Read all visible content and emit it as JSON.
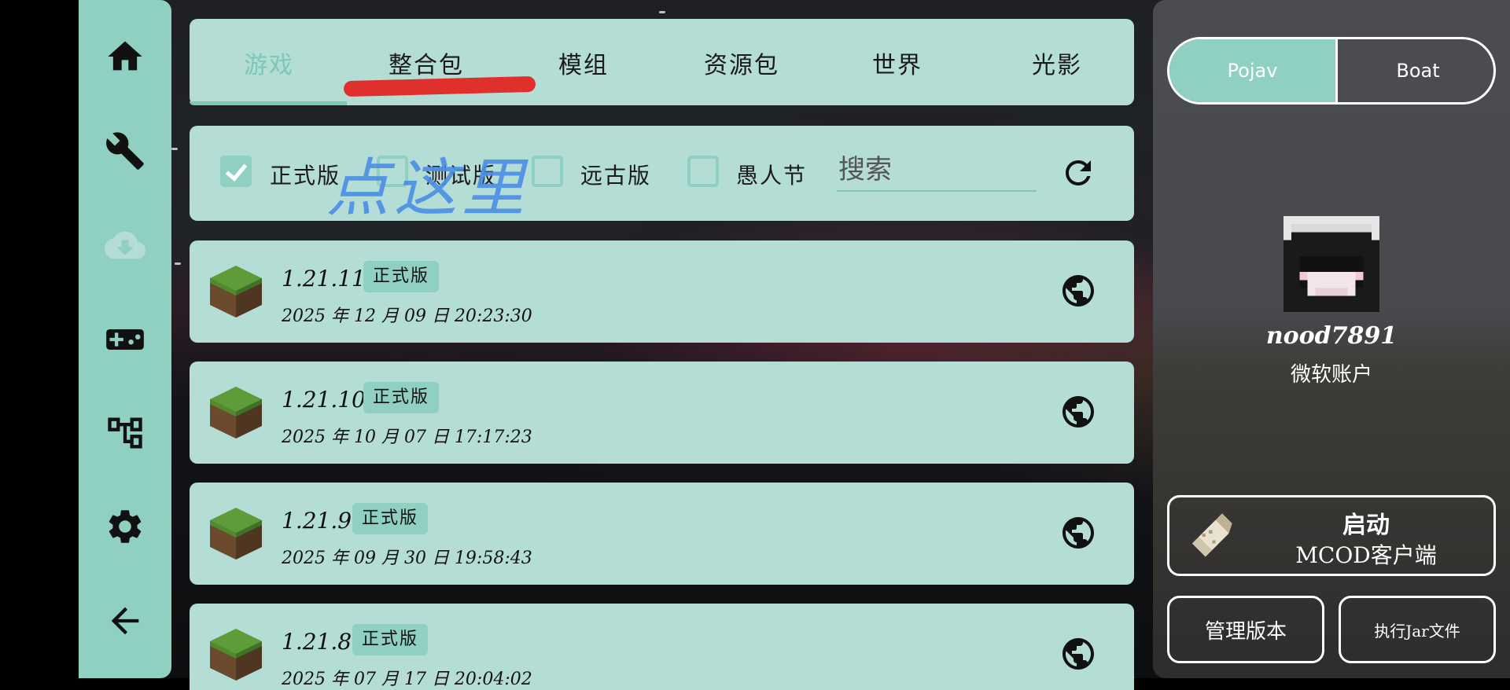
{
  "sidebar": {
    "items": [
      {
        "icon": "home-icon"
      },
      {
        "icon": "wrench-icon"
      },
      {
        "icon": "cloud-download-icon",
        "active": true
      },
      {
        "icon": "gamepad-icon"
      },
      {
        "icon": "hierarchy-icon"
      },
      {
        "icon": "gear-icon"
      },
      {
        "icon": "arrow-left-icon"
      }
    ]
  },
  "tabs": {
    "items": [
      {
        "label": "游戏",
        "active": true
      },
      {
        "label": "整合包"
      },
      {
        "label": "模组"
      },
      {
        "label": "资源包"
      },
      {
        "label": "世界"
      },
      {
        "label": "光影"
      }
    ]
  },
  "filters": {
    "release": {
      "label": "正式版",
      "checked": true
    },
    "snapshot": {
      "label": "测试版",
      "checked": false
    },
    "old": {
      "label": "远古版",
      "checked": false
    },
    "april": {
      "label": "愚人节",
      "checked": false
    },
    "search_placeholder": "搜索"
  },
  "annotation": {
    "text": "点这里",
    "color": "#4d8fe6"
  },
  "versions": [
    {
      "name": "1.21.11",
      "badge": "正式版",
      "date": "2025 年 12 月 09 日 20:23:30"
    },
    {
      "name": "1.21.10",
      "badge": "正式版",
      "date": "2025 年 10 月 07 日 17:17:23"
    },
    {
      "name": "1.21.9",
      "badge": "正式版",
      "date": "2025 年 09 月 30 日 19:58:43"
    },
    {
      "name": "1.21.8",
      "badge": "正式版",
      "date": "2025 年 07 月 17 日 20:04:02"
    }
  ],
  "right": {
    "toggle": {
      "left": "Pojav",
      "right": "Boat",
      "selected": "Pojav"
    },
    "username": "nood7891",
    "account_type": "微软账户",
    "launch": {
      "title": "启动",
      "subtitle": "MCOD客户端"
    },
    "manage_label": "管理版本",
    "jar_label": "执行Jar文件"
  },
  "colors": {
    "accent": "#8fd0c2",
    "panel": "#b3ddd5",
    "annotation_red": "#e0302e",
    "annotation_blue": "#4d8fe6"
  }
}
